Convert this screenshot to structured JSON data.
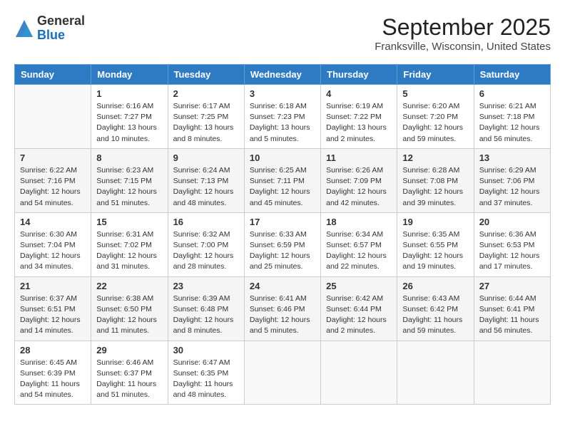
{
  "header": {
    "logo_general": "General",
    "logo_blue": "Blue",
    "month_title": "September 2025",
    "location": "Franksville, Wisconsin, United States"
  },
  "days_of_week": [
    "Sunday",
    "Monday",
    "Tuesday",
    "Wednesday",
    "Thursday",
    "Friday",
    "Saturday"
  ],
  "weeks": [
    [
      {
        "day": "",
        "info": ""
      },
      {
        "day": "1",
        "info": "Sunrise: 6:16 AM\nSunset: 7:27 PM\nDaylight: 13 hours\nand 10 minutes."
      },
      {
        "day": "2",
        "info": "Sunrise: 6:17 AM\nSunset: 7:25 PM\nDaylight: 13 hours\nand 8 minutes."
      },
      {
        "day": "3",
        "info": "Sunrise: 6:18 AM\nSunset: 7:23 PM\nDaylight: 13 hours\nand 5 minutes."
      },
      {
        "day": "4",
        "info": "Sunrise: 6:19 AM\nSunset: 7:22 PM\nDaylight: 13 hours\nand 2 minutes."
      },
      {
        "day": "5",
        "info": "Sunrise: 6:20 AM\nSunset: 7:20 PM\nDaylight: 12 hours\nand 59 minutes."
      },
      {
        "day": "6",
        "info": "Sunrise: 6:21 AM\nSunset: 7:18 PM\nDaylight: 12 hours\nand 56 minutes."
      }
    ],
    [
      {
        "day": "7",
        "info": "Sunrise: 6:22 AM\nSunset: 7:16 PM\nDaylight: 12 hours\nand 54 minutes."
      },
      {
        "day": "8",
        "info": "Sunrise: 6:23 AM\nSunset: 7:15 PM\nDaylight: 12 hours\nand 51 minutes."
      },
      {
        "day": "9",
        "info": "Sunrise: 6:24 AM\nSunset: 7:13 PM\nDaylight: 12 hours\nand 48 minutes."
      },
      {
        "day": "10",
        "info": "Sunrise: 6:25 AM\nSunset: 7:11 PM\nDaylight: 12 hours\nand 45 minutes."
      },
      {
        "day": "11",
        "info": "Sunrise: 6:26 AM\nSunset: 7:09 PM\nDaylight: 12 hours\nand 42 minutes."
      },
      {
        "day": "12",
        "info": "Sunrise: 6:28 AM\nSunset: 7:08 PM\nDaylight: 12 hours\nand 39 minutes."
      },
      {
        "day": "13",
        "info": "Sunrise: 6:29 AM\nSunset: 7:06 PM\nDaylight: 12 hours\nand 37 minutes."
      }
    ],
    [
      {
        "day": "14",
        "info": "Sunrise: 6:30 AM\nSunset: 7:04 PM\nDaylight: 12 hours\nand 34 minutes."
      },
      {
        "day": "15",
        "info": "Sunrise: 6:31 AM\nSunset: 7:02 PM\nDaylight: 12 hours\nand 31 minutes."
      },
      {
        "day": "16",
        "info": "Sunrise: 6:32 AM\nSunset: 7:00 PM\nDaylight: 12 hours\nand 28 minutes."
      },
      {
        "day": "17",
        "info": "Sunrise: 6:33 AM\nSunset: 6:59 PM\nDaylight: 12 hours\nand 25 minutes."
      },
      {
        "day": "18",
        "info": "Sunrise: 6:34 AM\nSunset: 6:57 PM\nDaylight: 12 hours\nand 22 minutes."
      },
      {
        "day": "19",
        "info": "Sunrise: 6:35 AM\nSunset: 6:55 PM\nDaylight: 12 hours\nand 19 minutes."
      },
      {
        "day": "20",
        "info": "Sunrise: 6:36 AM\nSunset: 6:53 PM\nDaylight: 12 hours\nand 17 minutes."
      }
    ],
    [
      {
        "day": "21",
        "info": "Sunrise: 6:37 AM\nSunset: 6:51 PM\nDaylight: 12 hours\nand 14 minutes."
      },
      {
        "day": "22",
        "info": "Sunrise: 6:38 AM\nSunset: 6:50 PM\nDaylight: 12 hours\nand 11 minutes."
      },
      {
        "day": "23",
        "info": "Sunrise: 6:39 AM\nSunset: 6:48 PM\nDaylight: 12 hours\nand 8 minutes."
      },
      {
        "day": "24",
        "info": "Sunrise: 6:41 AM\nSunset: 6:46 PM\nDaylight: 12 hours\nand 5 minutes."
      },
      {
        "day": "25",
        "info": "Sunrise: 6:42 AM\nSunset: 6:44 PM\nDaylight: 12 hours\nand 2 minutes."
      },
      {
        "day": "26",
        "info": "Sunrise: 6:43 AM\nSunset: 6:42 PM\nDaylight: 11 hours\nand 59 minutes."
      },
      {
        "day": "27",
        "info": "Sunrise: 6:44 AM\nSunset: 6:41 PM\nDaylight: 11 hours\nand 56 minutes."
      }
    ],
    [
      {
        "day": "28",
        "info": "Sunrise: 6:45 AM\nSunset: 6:39 PM\nDaylight: 11 hours\nand 54 minutes."
      },
      {
        "day": "29",
        "info": "Sunrise: 6:46 AM\nSunset: 6:37 PM\nDaylight: 11 hours\nand 51 minutes."
      },
      {
        "day": "30",
        "info": "Sunrise: 6:47 AM\nSunset: 6:35 PM\nDaylight: 11 hours\nand 48 minutes."
      },
      {
        "day": "",
        "info": ""
      },
      {
        "day": "",
        "info": ""
      },
      {
        "day": "",
        "info": ""
      },
      {
        "day": "",
        "info": ""
      }
    ]
  ]
}
